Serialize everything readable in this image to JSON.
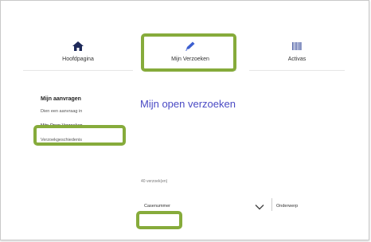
{
  "nav": {
    "home": {
      "label": "Hoofdpagina",
      "icon": "home-icon",
      "color": "#1e2a5a"
    },
    "mine": {
      "label": "Mijn Verzoeken",
      "icon": "pencil-icon",
      "color": "#3d5fd0"
    },
    "assets": {
      "label": "Activas",
      "icon": "barcode-icon",
      "color": "#5566aa"
    }
  },
  "sidebar": {
    "title": "Mijn aanvragen",
    "items": [
      {
        "label": "Dien een aanvraag in"
      },
      {
        "label": "Mijn Open Verzoeken"
      },
      {
        "label": "Verzoekgeschiedenis"
      }
    ]
  },
  "main": {
    "title": "Mijn open verzoeken",
    "count": "40 verzoek(en)",
    "columns": [
      "Casenummer",
      "Onderwerp"
    ]
  },
  "colors": {
    "accent": "#4a4ac4",
    "highlight": "#86ab3b"
  }
}
